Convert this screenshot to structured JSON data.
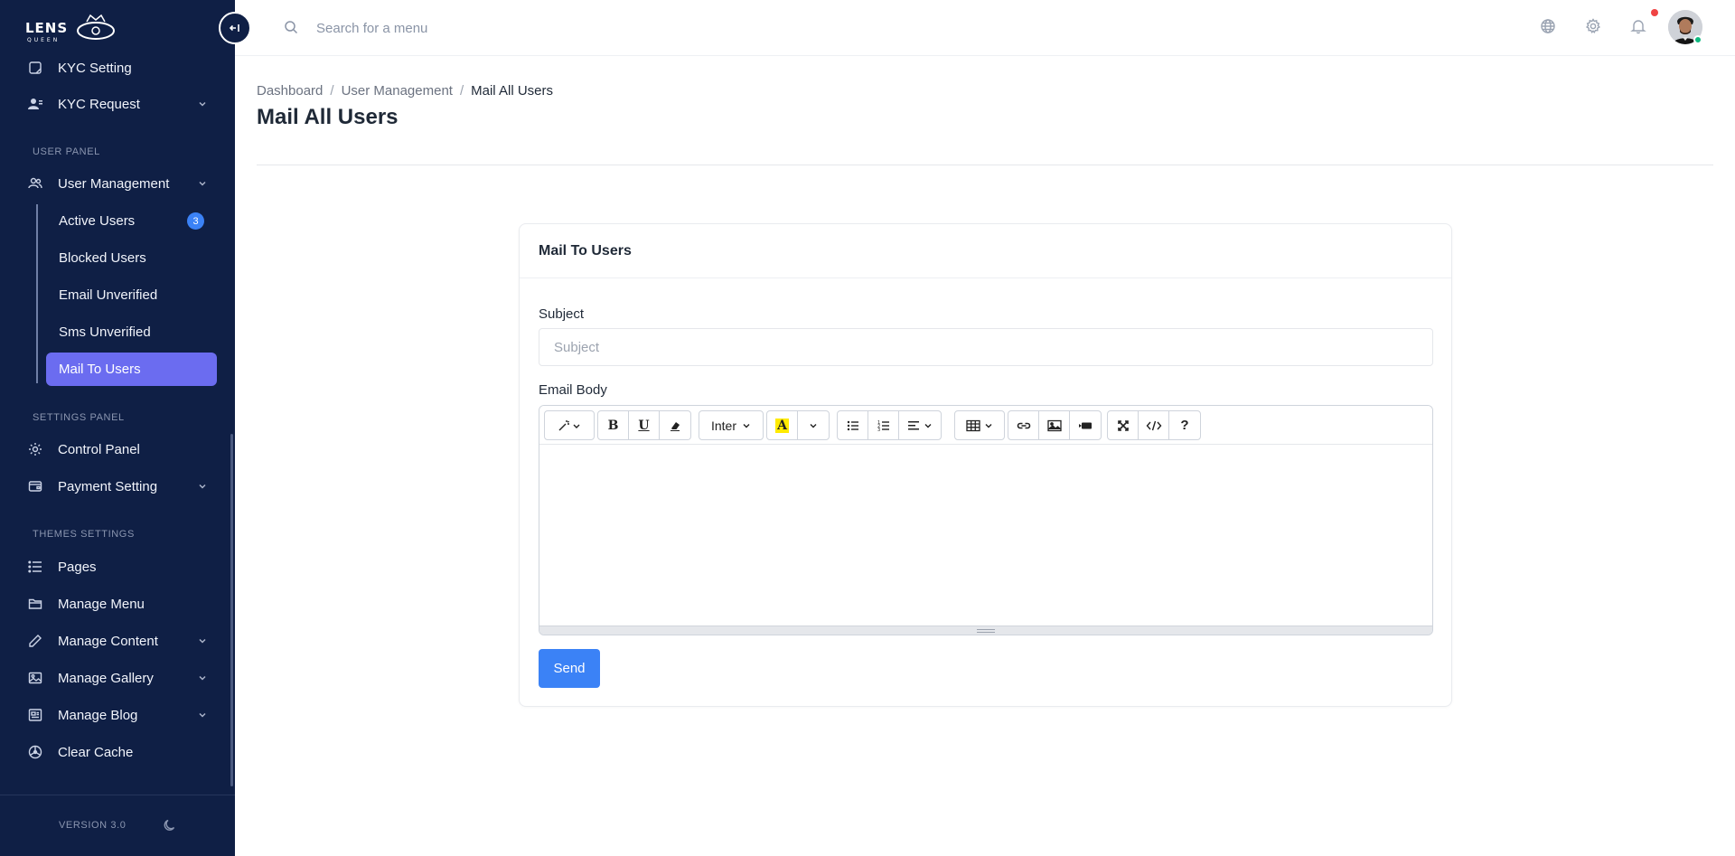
{
  "brand": {
    "logo_text": "LENS",
    "logo_sub": "QUEEN"
  },
  "sidebar": {
    "items_top": [
      {
        "label": "KYC Setting",
        "icon": "kyc-setting-icon"
      },
      {
        "label": "KYC Request",
        "icon": "kyc-request-icon",
        "expandable": true
      }
    ],
    "section_user": "USER PANEL",
    "user_management": {
      "label": "User Management",
      "icon": "users-icon"
    },
    "sub_items": [
      {
        "label": "Active Users",
        "badge": "3"
      },
      {
        "label": "Blocked Users"
      },
      {
        "label": "Email Unverified"
      },
      {
        "label": "Sms Unverified"
      },
      {
        "label": "Mail To Users",
        "active": true
      }
    ],
    "section_settings": "SETTINGS PANEL",
    "settings_items": [
      {
        "label": "Control Panel",
        "icon": "gear-icon"
      },
      {
        "label": "Payment Setting",
        "icon": "wallet-icon",
        "expandable": true
      }
    ],
    "section_themes": "THEMES SETTINGS",
    "theme_items": [
      {
        "label": "Pages",
        "icon": "list-icon"
      },
      {
        "label": "Manage Menu",
        "icon": "folder-icon"
      },
      {
        "label": "Manage Content",
        "icon": "pencil-icon",
        "expandable": true
      },
      {
        "label": "Manage Gallery",
        "icon": "image-icon",
        "expandable": true
      },
      {
        "label": "Manage Blog",
        "icon": "blog-icon",
        "expandable": true
      },
      {
        "label": "Clear Cache",
        "icon": "cache-icon"
      }
    ],
    "version": "VERSION 3.0"
  },
  "topbar": {
    "search_placeholder": "Search for a menu",
    "icons": [
      "globe-icon",
      "settings-icon",
      "bell-icon"
    ]
  },
  "breadcrumb": [
    "Dashboard",
    "User Management",
    "Mail All Users"
  ],
  "page_title": "Mail All Users",
  "card": {
    "title": "Mail To Users",
    "subject_label": "Subject",
    "subject_placeholder": "Subject",
    "subject_value": "",
    "body_label": "Email Body",
    "font_name": "Inter",
    "send_label": "Send"
  },
  "colors": {
    "sidebar_bg": "#0f1f45",
    "active_item": "#6b6cf0",
    "primary": "#3b82f6",
    "badge": "#3b82f6",
    "notification": "#ef4444",
    "online": "#10b981"
  }
}
